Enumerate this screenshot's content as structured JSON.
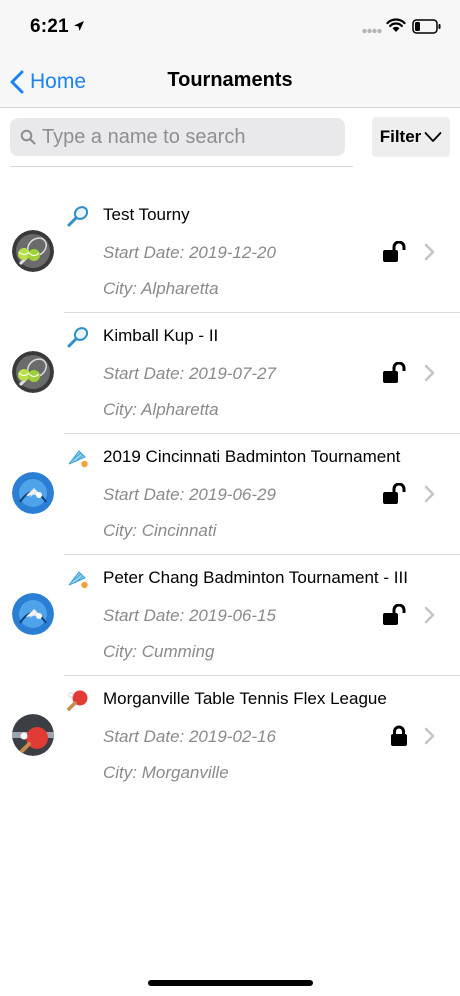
{
  "status_bar": {
    "time": "6:21"
  },
  "nav": {
    "back_label": "Home",
    "title": "Tournaments"
  },
  "search": {
    "placeholder": "Type a name to search",
    "value": ""
  },
  "filter": {
    "label": "Filter"
  },
  "tournaments": [
    {
      "name": "Test Tourny",
      "start_date": "Start Date: 2019-12-20",
      "city": "City: Alpharetta",
      "sport": "tennis",
      "lock": "unlocked"
    },
    {
      "name": "Kimball Kup - II",
      "start_date": "Start Date: 2019-07-27",
      "city": "City: Alpharetta",
      "sport": "tennis",
      "lock": "unlocked"
    },
    {
      "name": "2019 Cincinnati Badminton Tournament",
      "start_date": "Start Date: 2019-06-29",
      "city": "City: Cincinnati",
      "sport": "badminton",
      "lock": "unlocked"
    },
    {
      "name": "Peter Chang Badminton Tournament - III",
      "start_date": "Start Date: 2019-06-15",
      "city": "City: Cumming",
      "sport": "badminton",
      "lock": "unlocked"
    },
    {
      "name": "Morganville Table Tennis Flex League",
      "start_date": "Start Date: 2019-02-16",
      "city": "City: Morganville",
      "sport": "table-tennis",
      "lock": "locked"
    }
  ],
  "colors": {
    "accent": "#1a82f7",
    "secondary_text": "#8a8a8a",
    "nav_background": "#f7f7f7"
  }
}
